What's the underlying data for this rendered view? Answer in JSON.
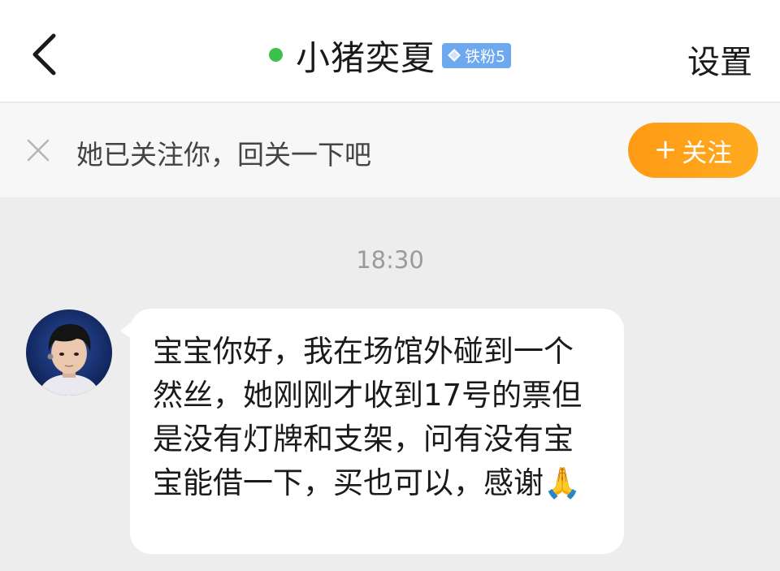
{
  "header": {
    "back_label": "<",
    "title": "小猪奕夏",
    "badge_label": "铁粉5",
    "settings_label": "设置",
    "online_color": "#3cc14d",
    "badge_color": "#6ea8ee"
  },
  "follow_bar": {
    "text": "她已关注你，回关一下吧",
    "button_plus": "+",
    "button_label": "关注",
    "button_color": "#ff9a15",
    "close_icon": "close-icon"
  },
  "chat": {
    "timestamp": "18:30",
    "messages": [
      {
        "sender": "received",
        "avatar_icon": "user-avatar",
        "text": "宝宝你好，我在场馆外碰到一个然丝，她刚刚才收到17号的票但是没有灯牌和支架，问有没有宝宝能借一下，买也可以，感谢🙏"
      }
    ]
  }
}
